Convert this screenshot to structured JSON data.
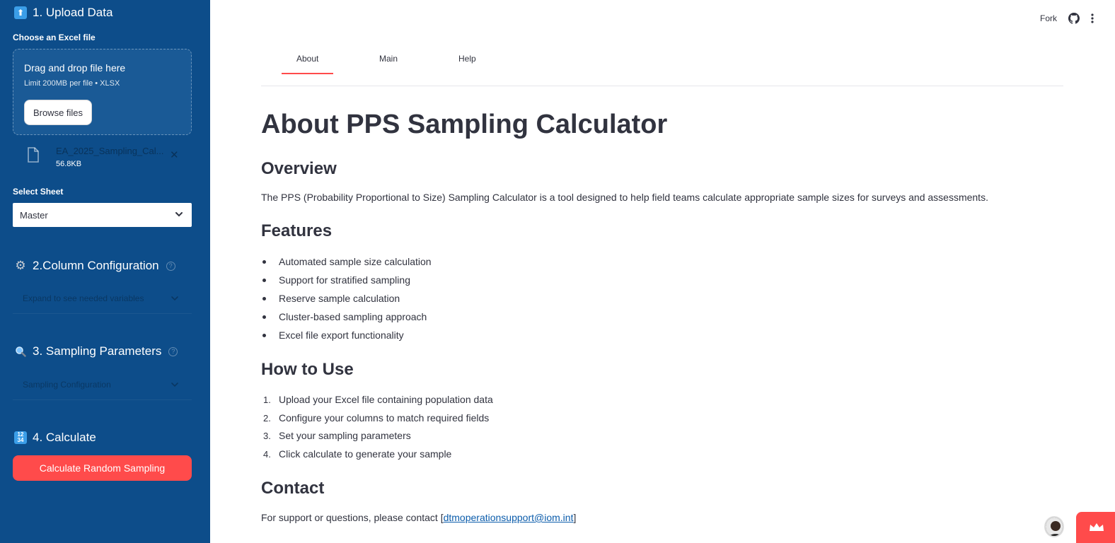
{
  "sidebar": {
    "upload": {
      "title": "1. Upload Data",
      "file_label": "Choose an Excel file",
      "drop_title": "Drag and drop file here",
      "drop_limit": "Limit 200MB per file • XLSX",
      "browse_label": "Browse files",
      "file_name": "EA_2025_Sampling_Cal...",
      "file_size": "56.8KB"
    },
    "sheet": {
      "label": "Select Sheet",
      "value": "Master"
    },
    "column_config": {
      "title": "2.Column Configuration",
      "expander_text": "Expand to see needed variables"
    },
    "sampling": {
      "title": "3. Sampling Parameters",
      "expander_text": "Sampling Configuration"
    },
    "calculate": {
      "title": "4. Calculate",
      "button_label": "Calculate Random Sampling"
    }
  },
  "toolbar": {
    "fork_label": "Fork"
  },
  "tabs": [
    {
      "label": "About"
    },
    {
      "label": "Main"
    },
    {
      "label": "Help"
    }
  ],
  "content": {
    "title": "About PPS Sampling Calculator",
    "overview": {
      "heading": "Overview",
      "text": "The PPS (Probability Proportional to Size) Sampling Calculator is a tool designed to help field teams calculate appropriate sample sizes for surveys and assessments."
    },
    "features": {
      "heading": "Features",
      "items": [
        "Automated sample size calculation",
        "Support for stratified sampling",
        "Reserve sample calculation",
        "Cluster-based sampling approach",
        "Excel file export functionality"
      ]
    },
    "how_to": {
      "heading": "How to Use",
      "items": [
        "Upload your Excel file containing population data",
        "Configure your columns to match required fields",
        "Set your sampling parameters",
        "Click calculate to generate your sample"
      ],
      "numbers": [
        "1.",
        "2.",
        "3.",
        "4."
      ]
    },
    "contact": {
      "heading": "Contact",
      "prefix": "For support or questions, please contact [",
      "email": "dtmoperationsupport@iom.int",
      "suffix": "]"
    }
  },
  "colors": {
    "sidebar_bg": "#0d4d8a",
    "accent": "#ff4b4b",
    "link": "#0b5cab"
  },
  "icons": {
    "upload": "upload-arrow-icon",
    "gear": "gear-icon",
    "search": "magnifier-icon",
    "numbers": "input-numbers-icon",
    "file": "file-icon",
    "github": "github-icon",
    "menu": "kebab-menu-icon",
    "crown": "crown-icon"
  }
}
